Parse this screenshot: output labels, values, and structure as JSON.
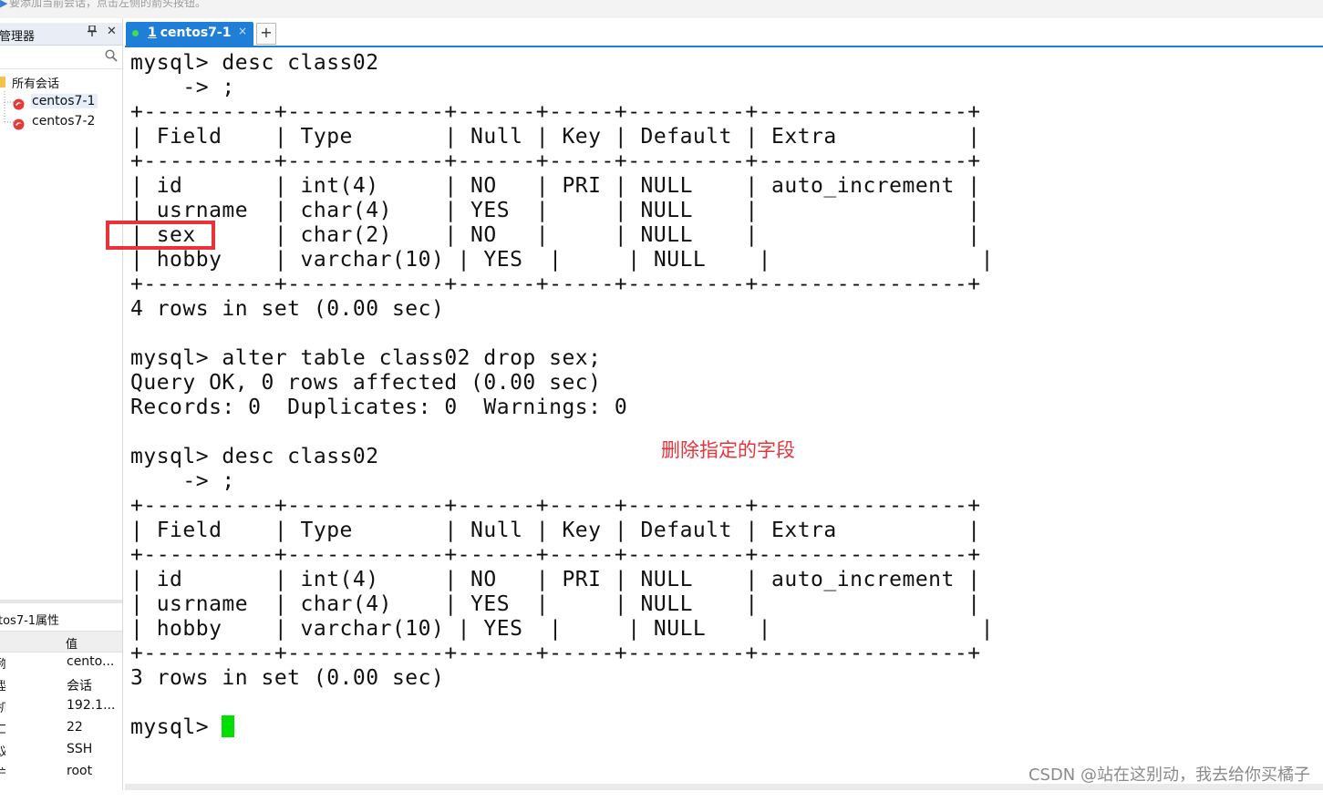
{
  "hint_bar": {
    "text": "要添加当前会话，点击左侧的箭头按钮。"
  },
  "session_manager": {
    "title": "管理器",
    "pin_icon": "pin-icon",
    "close_icon": "close-icon",
    "search_icon": "search-icon",
    "tree": {
      "root_label": "所有会话",
      "items": [
        {
          "label": "centos7-1",
          "selected": true
        },
        {
          "label": "centos7-2",
          "selected": false
        }
      ]
    }
  },
  "properties": {
    "title": "tos7-1属性",
    "value_header": "值",
    "rows": [
      {
        "key": "称",
        "value": "cento..."
      },
      {
        "key": "型",
        "value": "会话"
      },
      {
        "key": "机",
        "value": "192.1..."
      },
      {
        "key": "口",
        "value": "22"
      },
      {
        "key": "议",
        "value": "SSH"
      },
      {
        "key": "户名",
        "value": "root"
      }
    ]
  },
  "tabs": [
    {
      "number": "1",
      "label": "centos7-1",
      "status_color": "#3fe04a",
      "close": "×"
    }
  ],
  "tab_add": "+",
  "terminal": {
    "lines": [
      "mysql> desc class02",
      "    -> ;",
      "+----------+------------+------+-----+---------+----------------+",
      "| Field    | Type       | Null | Key | Default | Extra          |",
      "+----------+------------+------+-----+---------+----------------+",
      "| id       | int(4)     | NO   | PRI | NULL    | auto_increment |",
      "| usrname  | char(4)    | YES  |     | NULL    |                |",
      "| sex      | char(2)    | NO   |     | NULL    |                |",
      "| hobby    | varchar(10) | YES  |     | NULL    |                |",
      "+----------+------------+------+-----+---------+----------------+",
      "4 rows in set (0.00 sec)",
      "",
      "mysql> alter table class02 drop sex;",
      "Query OK, 0 rows affected (0.00 sec)",
      "Records: 0  Duplicates: 0  Warnings: 0",
      "",
      "mysql> desc class02",
      "    -> ;",
      "+----------+------------+------+-----+---------+----------------+",
      "| Field    | Type       | Null | Key | Default | Extra          |",
      "+----------+------------+------+-----+---------+----------------+",
      "| id       | int(4)     | NO   | PRI | NULL    | auto_increment |",
      "| usrname  | char(4)    | YES  |     | NULL    |                |",
      "| hobby    | varchar(10) | YES  |     | NULL    |                |",
      "+----------+------------+------+-----+---------+----------------+",
      "3 rows in set (0.00 sec)",
      "",
      "mysql> "
    ],
    "cursor_color": "#00e000"
  },
  "annotation": "删除指定的字段",
  "highlight_color": "#e8333a",
  "watermark": "CSDN @站在这别动，我去给你买橘子"
}
